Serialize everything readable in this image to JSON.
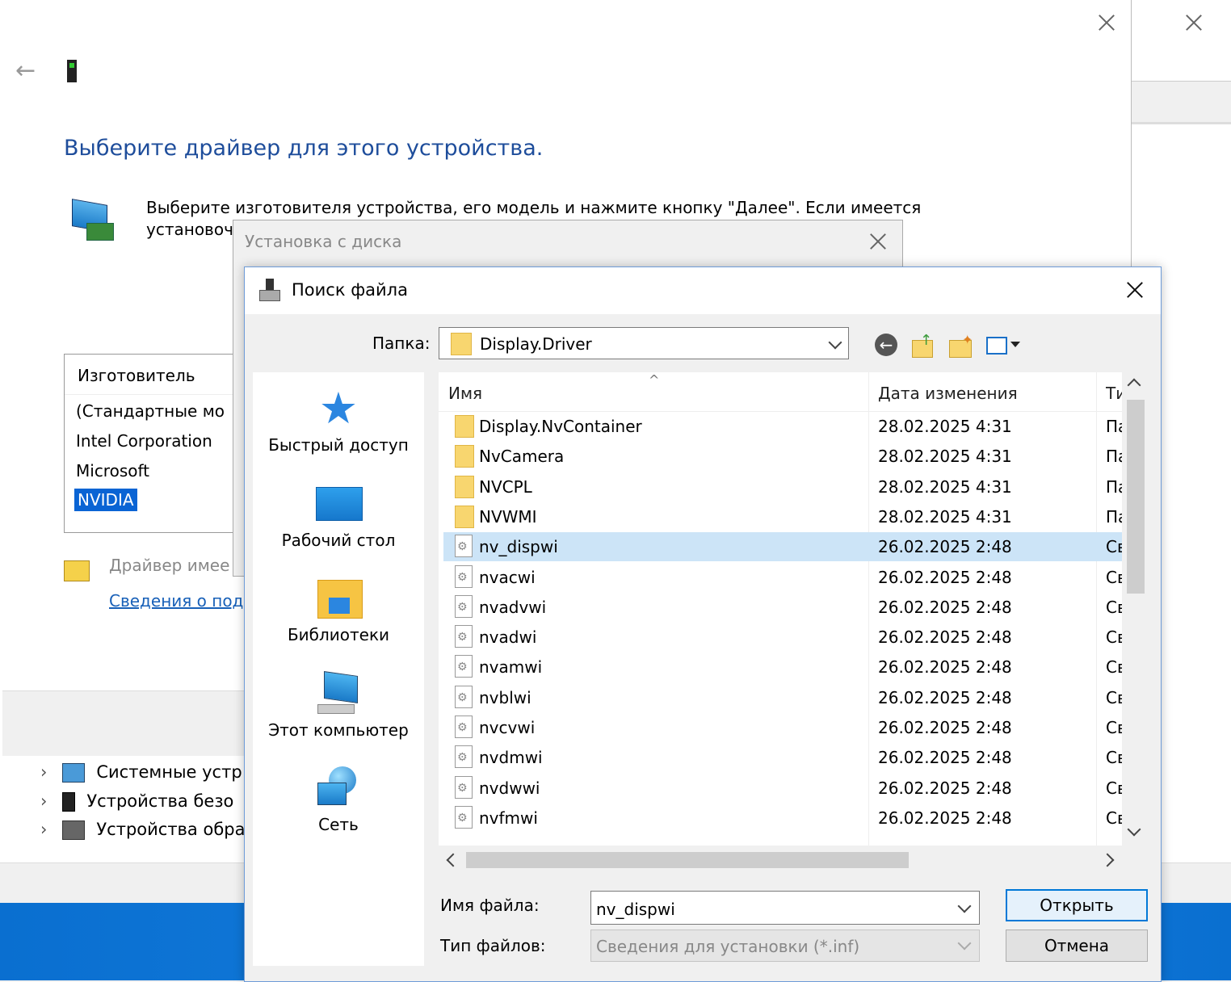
{
  "wizard": {
    "title": "Выберите драйвер для этого устройства.",
    "description": "Выберите изготовителя устройства, его модель и нажмите кнопку \"Далее\". Если имеется\nустановоч",
    "manufacturer_header": "Изготовитель",
    "manufacturers": [
      "(Стандартные мо",
      "Intel Corporation",
      "Microsoft",
      "NVIDIA"
    ],
    "selected_manufacturer": "NVIDIA",
    "signed_text": "Драйвер имее",
    "details_link": "Сведения о под"
  },
  "device_tree": [
    {
      "label": "Системные устр"
    },
    {
      "label": "Устройства безо"
    },
    {
      "label": "Устройства обра"
    }
  ],
  "install_disk": {
    "title": "Установка с диска"
  },
  "file_dialog": {
    "title": "Поиск файла",
    "folder_label": "Папка:",
    "folder_value": "Display.Driver",
    "places": [
      "Быстрый доступ",
      "Рабочий стол",
      "Библиотеки",
      "Этот компьютер",
      "Сеть"
    ],
    "columns": {
      "name": "Имя",
      "date": "Дата изменения",
      "type": "Ти"
    },
    "files": [
      {
        "name": "Display.NvContainer",
        "date": "28.02.2025 4:31",
        "type": "Па",
        "kind": "folder"
      },
      {
        "name": "NvCamera",
        "date": "28.02.2025 4:31",
        "type": "Па",
        "kind": "folder"
      },
      {
        "name": "NVCPL",
        "date": "28.02.2025 4:31",
        "type": "Па",
        "kind": "folder"
      },
      {
        "name": "NVWMI",
        "date": "28.02.2025 4:31",
        "type": "Па",
        "kind": "folder"
      },
      {
        "name": "nv_dispwi",
        "date": "26.02.2025 2:48",
        "type": "Св",
        "kind": "inf",
        "selected": true
      },
      {
        "name": "nvacwi",
        "date": "26.02.2025 2:48",
        "type": "Св",
        "kind": "inf"
      },
      {
        "name": "nvadvwi",
        "date": "26.02.2025 2:48",
        "type": "Св",
        "kind": "inf"
      },
      {
        "name": "nvadwi",
        "date": "26.02.2025 2:48",
        "type": "Св",
        "kind": "inf"
      },
      {
        "name": "nvamwi",
        "date": "26.02.2025 2:48",
        "type": "Св",
        "kind": "inf"
      },
      {
        "name": "nvblwi",
        "date": "26.02.2025 2:48",
        "type": "Св",
        "kind": "inf"
      },
      {
        "name": "nvcvwi",
        "date": "26.02.2025 2:48",
        "type": "Св",
        "kind": "inf"
      },
      {
        "name": "nvdmwi",
        "date": "26.02.2025 2:48",
        "type": "Св",
        "kind": "inf"
      },
      {
        "name": "nvdwwi",
        "date": "26.02.2025 2:48",
        "type": "Св",
        "kind": "inf"
      },
      {
        "name": "nvfmwi",
        "date": "26.02.2025 2:48",
        "type": "Св",
        "kind": "inf"
      }
    ],
    "filename_label": "Имя файла:",
    "filename_value": "nv_dispwi",
    "filetype_label": "Тип файлов:",
    "filetype_value": "Сведения для установки (*.inf)",
    "open_button": "Открыть",
    "cancel_button": "Отмена"
  }
}
